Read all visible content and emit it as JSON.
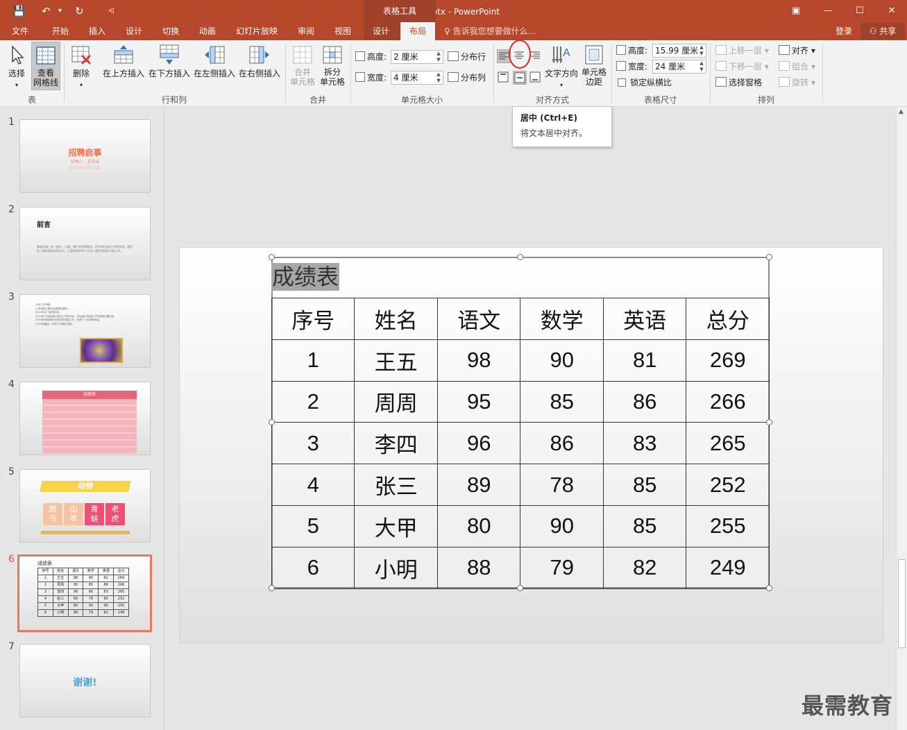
{
  "window": {
    "title": "谢谢.pptx - PowerPoint",
    "context_group": "表格工具",
    "controls": [
      "▣",
      "—",
      "☐",
      "✕"
    ]
  },
  "quick_access": {
    "save_icon": "💾",
    "undo_icon": "↶",
    "undo_drop": "▾",
    "redo_icon": "↻",
    "customize_icon": "⩤"
  },
  "tabs": [
    "文件",
    "开始",
    "插入",
    "设计",
    "切换",
    "动画",
    "幻灯片放映",
    "审阅",
    "视图"
  ],
  "context_tabs": [
    "设计",
    "布局"
  ],
  "active_tab": "布局",
  "tell_me": "告诉我您想要做什么...",
  "account": {
    "login": "登录",
    "share": "共享"
  },
  "ribbon": {
    "table_group": {
      "label": "表",
      "select": "选择",
      "gridlines": "查看\n网格线"
    },
    "rows_cols_group": {
      "label": "行和列",
      "delete": "删除",
      "insert_above": "在上方插入",
      "insert_below": "在下方插入",
      "insert_left": "在左侧插入",
      "insert_right": "在右侧插入"
    },
    "merge_group": {
      "label": "合并",
      "merge_cells": "合并\n单元格",
      "split_cells": "拆分\n单元格"
    },
    "cell_size_group": {
      "label": "单元格大小",
      "height_label": "高度:",
      "height_value": "2 厘米",
      "width_label": "宽度:",
      "width_value": "4 厘米",
      "distribute_rows": "分布行",
      "distribute_cols": "分布列"
    },
    "alignment_group": {
      "label": "对齐方式",
      "text_direction": "文字方向",
      "cell_margins": "单元格\n边距"
    },
    "table_size_group": {
      "label": "表格尺寸",
      "height_label": "高度:",
      "height_value": "15.99 厘米",
      "width_label": "宽度:",
      "width_value": "24 厘米",
      "lock_ratio": "锁定纵横比"
    },
    "arrange_group": {
      "label": "排列",
      "bring_forward": "上移一层",
      "send_backward": "下移一层",
      "selection_pane": "选择窗格",
      "align": "对齐",
      "group": "组合",
      "rotate": "旋转"
    }
  },
  "tooltip": {
    "title": "居中 (Ctrl+E)",
    "desc": "将文本居中对齐。"
  },
  "slides": [
    {
      "num": "1",
      "title": "招聘启事",
      "sub1": "招聘人：某某某",
      "sub2": "2021年1月12日"
    },
    {
      "num": "2",
      "title": "前言",
      "body": "随着发展，在一起中，力量，我们共同的事业，2019年全体工作的时候，我们在人事有限的时间之内，让更多的优秀人才加入我们的团队中来工作。"
    },
    {
      "num": "3",
      "body": "公司工作流程\n工作流程主要包括整理流程内，\n2019年以下各项内容，\n2019年下来由我们完成工作的内容，并由我们完成以下的流程主要内容，\n2019年完成我们的任务的流程工作，完成了工作流程内容。\n2019年最后，完成了完美的流程。"
    },
    {
      "num": "4",
      "title": "成绩表"
    },
    {
      "num": "5",
      "title": "动物",
      "animals": [
        "斑\n马",
        "山\n羊",
        "青\n蛙",
        "老\n虎"
      ]
    },
    {
      "num": "6",
      "title": "成绩表"
    },
    {
      "num": "7",
      "title": "谢谢!"
    }
  ],
  "active_slide": "6",
  "table": {
    "title": "成绩表",
    "headers": [
      "序号",
      "姓名",
      "语文",
      "数学",
      "英语",
      "总分"
    ],
    "rows": [
      [
        "1",
        "王五",
        "98",
        "90",
        "81",
        "269"
      ],
      [
        "2",
        "周周",
        "95",
        "85",
        "86",
        "266"
      ],
      [
        "3",
        "李四",
        "96",
        "86",
        "83",
        "265"
      ],
      [
        "4",
        "张三",
        "89",
        "78",
        "85",
        "252"
      ],
      [
        "5",
        "大甲",
        "80",
        "90",
        "85",
        "255"
      ],
      [
        "6",
        "小明",
        "88",
        "79",
        "82",
        "249"
      ]
    ]
  },
  "watermark": "最需教育",
  "colors": {
    "accent": "#b7472a",
    "accent_dark": "#a0412a",
    "ribbon_bg": "#f3f3f3",
    "selected_slide_border": "#e8775a",
    "highlight_circle": "#e0282e"
  }
}
